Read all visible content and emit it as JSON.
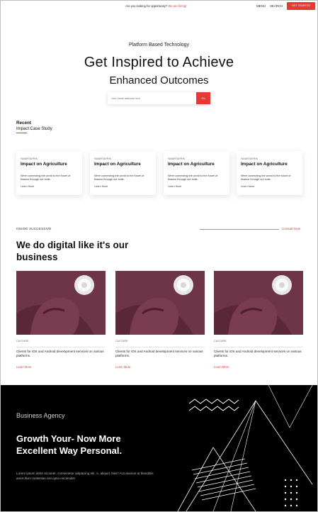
{
  "topbar": {
    "promo_prefix": "Are you looking for opportunity?",
    "promo_link": "We are hiring!",
    "menu_label": "MENU",
    "search_label": "SEARCH",
    "cta_label": "GET STARTED"
  },
  "hero": {
    "kicker": "Platform Based Technology",
    "title": "Get Inspired to Achieve",
    "subtitle": "Enhanced Outcomes",
    "search_placeholder": "Your email address here",
    "search_button": "Go"
  },
  "recent": {
    "label": "Recent",
    "sub": "Impact Case Study",
    "cards": [
      {
        "tag": "SMARTAFRIK",
        "title": "Impact on Agriculture",
        "desc": "Were connecting the world to the future of finance through our suite.",
        "more": "Learn More"
      },
      {
        "tag": "SMARTAFRIK",
        "title": "Impact on Agriculture",
        "desc": "Were connecting the world to the future of finance through our suite.",
        "more": "Learn More"
      },
      {
        "tag": "SMARTAFRIK",
        "title": "Impact on Agriculture",
        "desc": "Were connecting the world to the future of finance through our suite.",
        "more": "Learn More"
      },
      {
        "tag": "SMARTAFRIK",
        "title": "Impact on Agriculture",
        "desc": "Were connecting the world to the future of finance through our suite.",
        "more": "Learn More"
      }
    ]
  },
  "inside": {
    "label": "INSIDE SUCCESSIVE",
    "consult": "Consult Now",
    "title": "We do digital like it's our business",
    "posts": [
      {
        "category": "CULTURE",
        "text": "Clients for iOS and Android development services on various platforms.",
        "more": "Learn More"
      },
      {
        "category": "CULTURE",
        "text": "Clients for iOS and Android development services on various platforms.",
        "more": "Learn More"
      },
      {
        "category": "CULTURE",
        "text": "Clients for iOS and Android development services on various platforms.",
        "more": "Learn More"
      }
    ]
  },
  "agency": {
    "label": "Business Agency",
    "title": "Growth Your- Now More Excellent Way Personal.",
    "lorem": "Lorem ipsum dolor sit amet, consectetur adipiscing elit. A, aliquid. Nisi? Accusamus at blanditiis amet illum molestias nisi optio reiciendis!"
  },
  "colors": {
    "accent": "#e53935",
    "dark": "#000000",
    "post_image": "#6e3447"
  },
  "icons": {
    "search_button_icon": "none",
    "lamp": "round-wall-lamp-image",
    "chair": "velvet-chair-image"
  }
}
